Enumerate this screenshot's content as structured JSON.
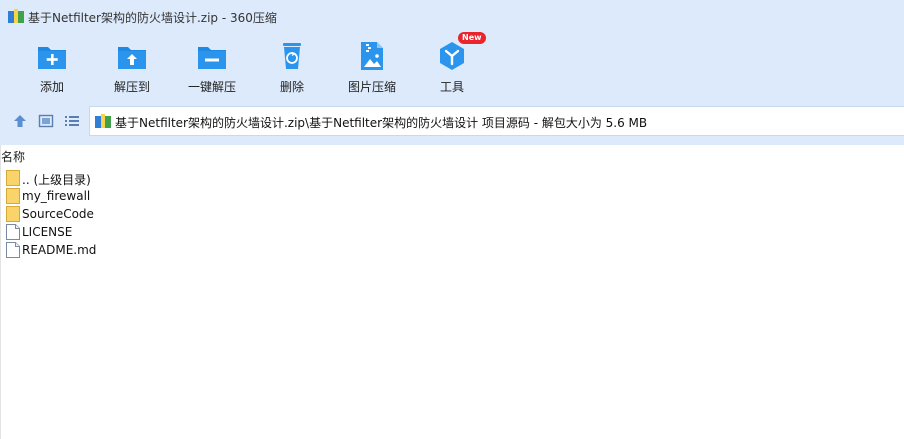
{
  "window": {
    "title": "基于Netfilter架构的防火墙设计.zip - 360压缩"
  },
  "toolbar": {
    "buttons": [
      {
        "label": "添加",
        "icon": "add-icon"
      },
      {
        "label": "解压到",
        "icon": "extract-to-icon"
      },
      {
        "label": "一键解压",
        "icon": "one-click-extract-icon"
      },
      {
        "label": "删除",
        "icon": "delete-icon"
      },
      {
        "label": "图片压缩",
        "icon": "image-compress-icon"
      },
      {
        "label": "工具",
        "icon": "tools-icon",
        "badge": "New"
      }
    ]
  },
  "address_bar": {
    "path": "基于Netfilter架构的防火墙设计.zip\\基于Netfilter架构的防火墙设计 项目源码 - 解包大小为 5.6 MB"
  },
  "file_list": {
    "column_name": "名称",
    "items": [
      {
        "name": ".. (上级目录)",
        "type": "folder"
      },
      {
        "name": "my_firewall",
        "type": "folder"
      },
      {
        "name": "SourceCode",
        "type": "folder"
      },
      {
        "name": "LICENSE",
        "type": "file"
      },
      {
        "name": "README.md",
        "type": "file"
      }
    ]
  },
  "colors": {
    "chrome_bg": "#dceafb",
    "accent_blue": "#1e88e5",
    "folder_yellow": "#f5c542",
    "badge_red": "#e8242c"
  }
}
